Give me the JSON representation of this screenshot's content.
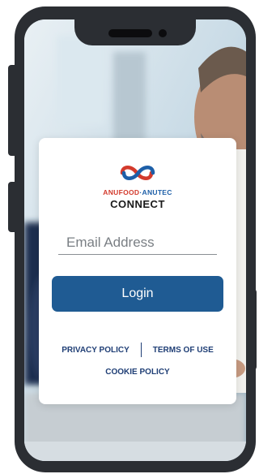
{
  "brand": {
    "name_left": "ANUFOOD",
    "separator": "·",
    "name_right": "ANUTEC",
    "product": "CONNECT",
    "colors": {
      "red": "#d33a2c",
      "blue": "#1d5fa8",
      "navy": "#1d3f7a"
    }
  },
  "login_form": {
    "email_placeholder": "Email Address",
    "login_label": "Login",
    "button_color": "#1f5b93"
  },
  "footer_links": {
    "privacy": "PRIVACY POLICY",
    "terms": "TERMS OF USE",
    "cookie": "COOKIE POLICY"
  },
  "icons": [
    "brand-logo-icon"
  ]
}
